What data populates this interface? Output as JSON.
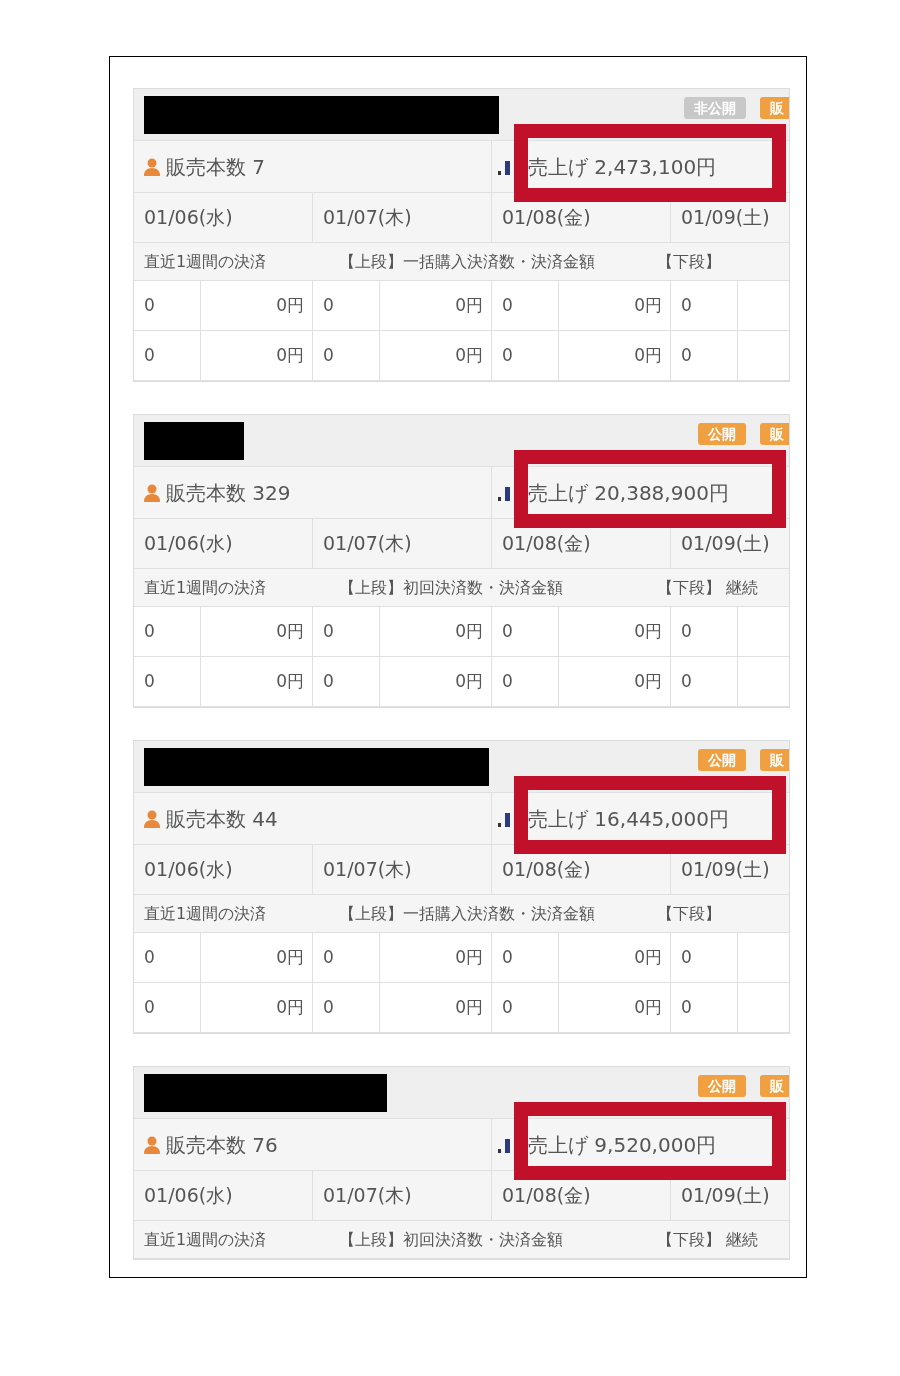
{
  "cards": [
    {
      "badges": [
        {
          "label": "非公開",
          "kind": "private"
        },
        {
          "label": "販",
          "kind": "sale"
        }
      ],
      "sales_count": "販売本数 7",
      "revenue": "売上げ 2,473,100円",
      "highlighted": true,
      "dates": [
        "01/06(水)",
        "01/07(木)",
        "01/08(金)",
        "01/09(土)"
      ],
      "info": {
        "label": "直近1週間の決済",
        "upper": "【上段】一括購入決済数・決済金額",
        "lower": "【下段】"
      },
      "rows": [
        [
          "0",
          "0円",
          "0",
          "0円",
          "0",
          "0円",
          "0"
        ],
        [
          "0",
          "0円",
          "0",
          "0円",
          "0",
          "0円",
          "0"
        ]
      ]
    },
    {
      "badges": [
        {
          "label": "公開",
          "kind": "public"
        },
        {
          "label": "販",
          "kind": "sale"
        }
      ],
      "sales_count": "販売本数 329",
      "revenue": "売上げ 20,388,900円",
      "highlighted": true,
      "dates": [
        "01/06(水)",
        "01/07(木)",
        "01/08(金)",
        "01/09(土)"
      ],
      "info": {
        "label": "直近1週間の決済",
        "upper": "【上段】初回決済数・決済金額",
        "lower": "【下段】 継続"
      },
      "rows": [
        [
          "0",
          "0円",
          "0",
          "0円",
          "0",
          "0円",
          "0"
        ],
        [
          "0",
          "0円",
          "0",
          "0円",
          "0",
          "0円",
          "0"
        ]
      ]
    },
    {
      "badges": [
        {
          "label": "公開",
          "kind": "public"
        },
        {
          "label": "販",
          "kind": "sale"
        }
      ],
      "sales_count": "販売本数 44",
      "revenue": "売上げ 16,445,000円",
      "highlighted": true,
      "dates": [
        "01/06(水)",
        "01/07(木)",
        "01/08(金)",
        "01/09(土)"
      ],
      "info": {
        "label": "直近1週間の決済",
        "upper": "【上段】一括購入決済数・決済金額",
        "lower": "【下段】"
      },
      "rows": [
        [
          "0",
          "0円",
          "0",
          "0円",
          "0",
          "0円",
          "0"
        ],
        [
          "0",
          "0円",
          "0",
          "0円",
          "0",
          "0円",
          "0"
        ]
      ]
    },
    {
      "badges": [
        {
          "label": "公開",
          "kind": "public"
        },
        {
          "label": "販",
          "kind": "sale"
        }
      ],
      "sales_count": "販売本数 76",
      "revenue": "売上げ 9,520,000円",
      "highlighted": true,
      "dates": [
        "01/06(水)",
        "01/07(木)",
        "01/08(金)",
        "01/09(土)"
      ],
      "info": {
        "label": "直近1週間の決済",
        "upper": "【上段】初回決済数・決済金額",
        "lower": "【下段】 継続"
      }
    }
  ]
}
